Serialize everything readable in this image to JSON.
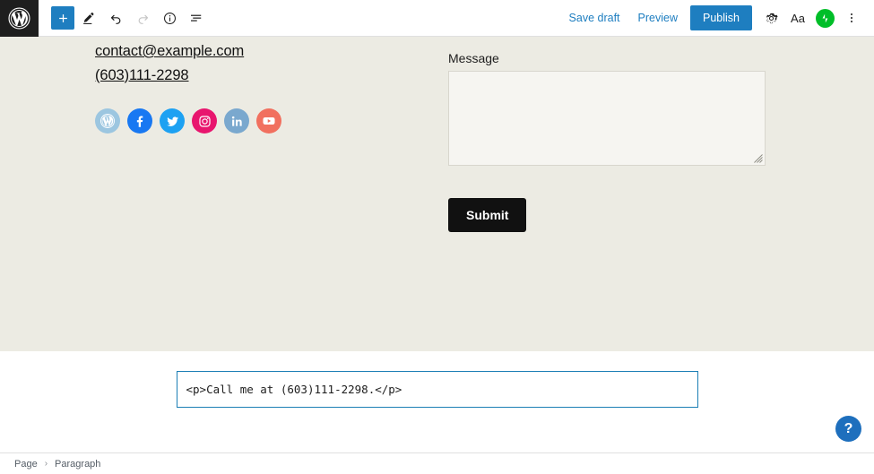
{
  "app": {
    "logo_icon": "wordpress-logo-icon"
  },
  "toolbar": {
    "add_block_label": "+",
    "tools": [
      {
        "name": "add-block-button",
        "icon": "plus-icon",
        "label": "+"
      },
      {
        "name": "tools-pencil-button",
        "icon": "pencil-icon"
      },
      {
        "name": "undo-button",
        "icon": "undo-arrow-icon"
      },
      {
        "name": "redo-button",
        "icon": "redo-arrow-icon"
      },
      {
        "name": "details-button",
        "icon": "info-circle-icon"
      },
      {
        "name": "list-view-button",
        "icon": "list-view-icon"
      }
    ],
    "save_draft_label": "Save draft",
    "preview_label": "Preview",
    "publish_label": "Publish",
    "settings_icon": "gear-icon",
    "typography_label": "Aa",
    "jetpack_icon": "jetpack-lightning-icon",
    "more_menu_icon": "three-dots-vertical-icon",
    "accent_blue": "#1e7ec0",
    "jetpack_green": "#00be28"
  },
  "content": {
    "background_color": "#ecebe3",
    "email_link": "contact@example.com",
    "phone_link": "(603)111-2298",
    "social_links": [
      {
        "name": "wordpress",
        "color": "#9cc6e0"
      },
      {
        "name": "facebook",
        "color": "#1878f2"
      },
      {
        "name": "twitter",
        "color": "#1da1f2"
      },
      {
        "name": "instagram",
        "color": "#e8156e"
      },
      {
        "name": "linkedin",
        "color": "#7aa8ce"
      },
      {
        "name": "youtube",
        "color": "#f1705f"
      }
    ],
    "message_label": "Message",
    "message_value": "",
    "submit_label": "Submit",
    "submit_bg": "#111111"
  },
  "html_block": {
    "code": "<p>Call me at (603)111-2298.</p>",
    "selected_border_color": "#1b7eb5"
  },
  "help": {
    "label": "?",
    "color": "#1e6fbd"
  },
  "statusbar": {
    "breadcrumb": [
      {
        "label": "Page"
      },
      {
        "label": "Paragraph"
      }
    ],
    "separator": "›"
  }
}
